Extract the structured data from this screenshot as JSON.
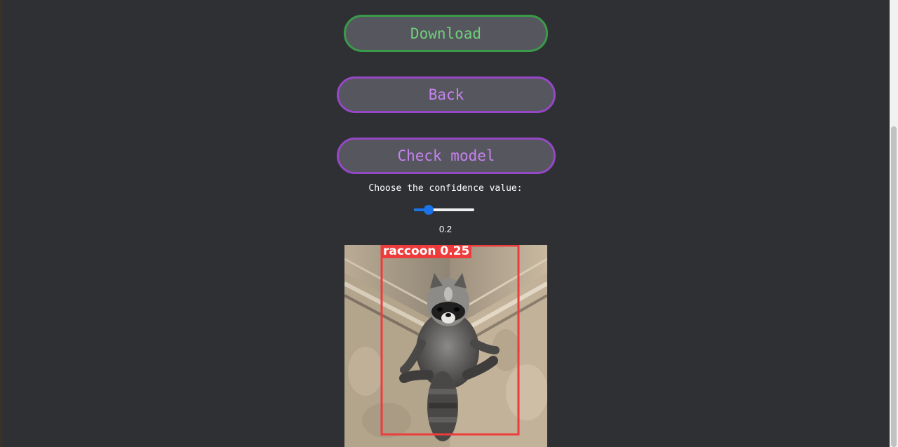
{
  "buttons": {
    "download_label": "Download",
    "back_label": "Back",
    "check_model_label": "Check model"
  },
  "confidence": {
    "label": "Choose the confidence value:",
    "value": 0.2,
    "value_text": "0.2",
    "min": 0,
    "max": 1
  },
  "result_image": {
    "detection_label": "raccoon",
    "detection_score": "0.25",
    "box_color": "#ee3b3b"
  },
  "colors": {
    "background": "#2f3034",
    "download_border": "#3a9a4a",
    "download_text": "#6fd07a",
    "purple_border": "#9548c6",
    "purple_text": "#c683ee",
    "slider_accent": "#1a73e8"
  }
}
